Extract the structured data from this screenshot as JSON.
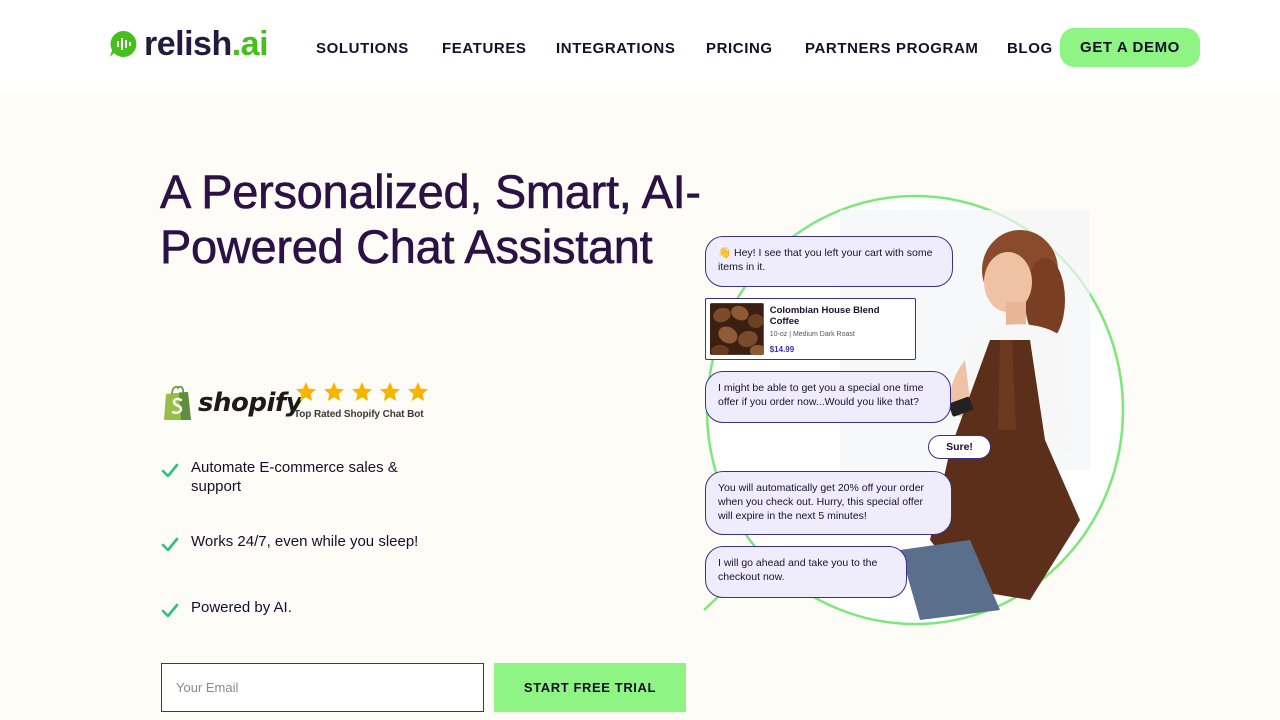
{
  "header": {
    "logo_text": "relish",
    "logo_suffix": ".ai",
    "nav": [
      "SOLUTIONS",
      "FEATURES",
      "INTEGRATIONS",
      "PRICING",
      "PARTNERS PROGRAM",
      "BLOG"
    ],
    "demo_button": "GET A DEMO"
  },
  "hero": {
    "headline": "A Personalized, Smart, AI-Powered Chat Assistant",
    "shopify_word": "shopify",
    "rating_caption": "Top Rated Shopify Chat Bot",
    "stars": 5,
    "features": [
      "Automate E-commerce sales & support",
      "Works 24/7, even while you sleep!",
      "Powered by AI."
    ],
    "email_placeholder": "Your Email",
    "trial_button": "START FREE TRIAL"
  },
  "chat": {
    "msg1": "👋 Hey! I see that you left your cart with some items in it.",
    "product": {
      "name": "Colombian House Blend Coffee",
      "meta": "10-oz | Medium Dark Roast",
      "price": "$14.99"
    },
    "msg2": "I might be able to get you a special one time offer if you order now...Would you like that?",
    "reply": "Sure!",
    "msg3": "You will automatically get 20% off your order when you check out. Hurry, this special offer will expire in the next 5 minutes!",
    "msg4": "I will go ahead and take you to the checkout now."
  },
  "colors": {
    "accent_green": "#8ef585",
    "brand_green": "#43c11a",
    "headline_purple": "#2b1144",
    "bubble_border": "#3b2f8f"
  }
}
